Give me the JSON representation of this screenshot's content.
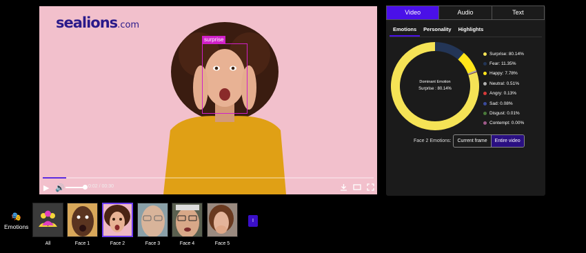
{
  "video": {
    "logo_main": "sealions",
    "logo_suffix": ".com",
    "face_label": "surprise",
    "time": "0:02 / 00:30",
    "progress": 0.07,
    "volume": 0.85
  },
  "panel": {
    "tabs": [
      {
        "label": "Video",
        "active": true
      },
      {
        "label": "Audio",
        "active": false
      },
      {
        "label": "Text",
        "active": false
      }
    ],
    "subtabs": [
      {
        "label": "Emotions",
        "active": true
      },
      {
        "label": "Personality",
        "active": false
      },
      {
        "label": "Highlights",
        "active": false
      }
    ],
    "donut_title": "Dominant Emotion",
    "donut_value": "Surprise : 80.14%",
    "face_emotions_label": "Face 2 Emotions:",
    "toggle": {
      "current": "Current frame",
      "entire": "Entire video"
    }
  },
  "chart_data": {
    "type": "pie",
    "categories": [
      "Surprise",
      "Fear",
      "Happy",
      "Neutral",
      "Angry",
      "Sad",
      "Disgust",
      "Contempt"
    ],
    "values": [
      80.14,
      11.35,
      7.78,
      0.51,
      0.13,
      0.08,
      0.01,
      0.0
    ],
    "labels": [
      "Surprise: 80.14%",
      "Fear: 11.35%",
      "Happy: 7.78%",
      "Neutral: 0.51%",
      "Angry: 0.13%",
      "Sad: 0.08%",
      "Disgust: 0.01%",
      "Contempt: 0.00%"
    ],
    "colors": [
      "#f5e356",
      "#233556",
      "#ffe51a",
      "#b0b0b0",
      "#d63a3a",
      "#3a4a9a",
      "#4a7a3a",
      "#a05a8a"
    ],
    "legend": "right"
  },
  "bottom": {
    "emotions_label": "Emotions",
    "thumbs": [
      {
        "label": "All"
      },
      {
        "label": "Face 1"
      },
      {
        "label": "Face 2"
      },
      {
        "label": "Face 3"
      },
      {
        "label": "Face 4"
      },
      {
        "label": "Face 5"
      }
    ],
    "next_label": "I"
  }
}
